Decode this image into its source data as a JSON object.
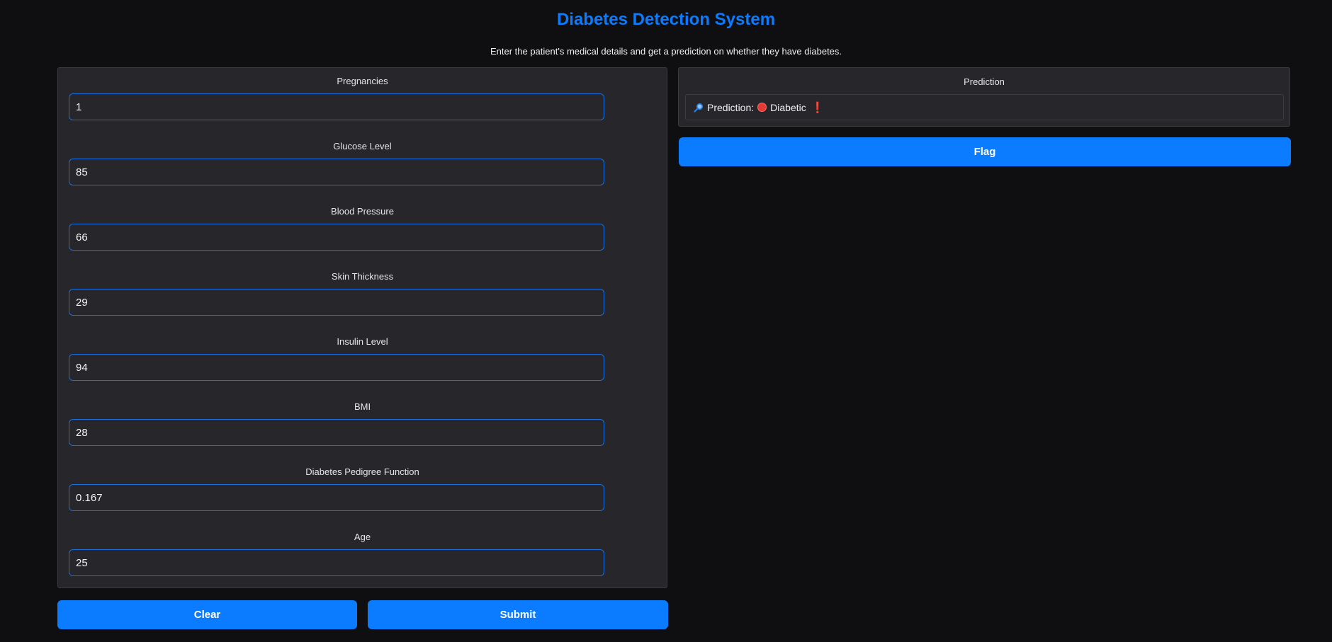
{
  "header": {
    "title": "Diabetes Detection System",
    "description": "Enter the patient's medical details and get a prediction on whether they have diabetes."
  },
  "fields": [
    {
      "label": "Pregnancies",
      "value": "1"
    },
    {
      "label": "Glucose Level",
      "value": "85"
    },
    {
      "label": "Blood Pressure",
      "value": "66"
    },
    {
      "label": "Skin Thickness",
      "value": "29"
    },
    {
      "label": "Insulin Level",
      "value": "94"
    },
    {
      "label": "BMI",
      "value": "28"
    },
    {
      "label": "Diabetes Pedigree Function",
      "value": "0.167"
    },
    {
      "label": "Age",
      "value": "25"
    }
  ],
  "buttons": {
    "clear": "Clear",
    "submit": "Submit",
    "flag": "Flag"
  },
  "output": {
    "label": "Prediction",
    "prefix": "Prediction:",
    "result": "Diabetic",
    "exclaim": "❗",
    "icons": [
      "magnifier-icon",
      "red-circle-icon",
      "exclamation-icon"
    ]
  },
  "colors": {
    "accent": "#0b7cff",
    "background": "#0f0f11",
    "panel": "#27272b",
    "alert": "#e53935"
  }
}
